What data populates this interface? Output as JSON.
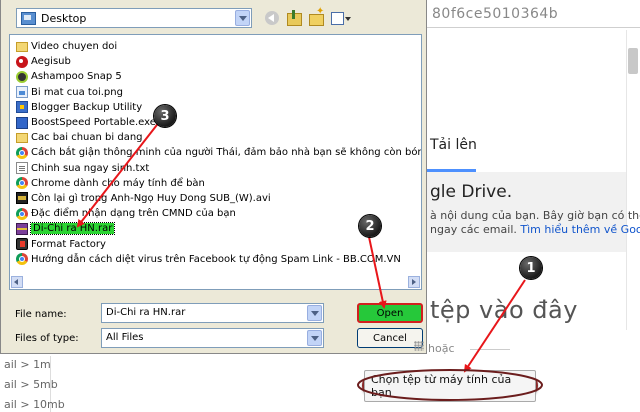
{
  "background": {
    "url_fragment": "80f6ce5010364b",
    "upload_tab": "Tải lên",
    "drive_heading": "gle Drive.",
    "desc_line1": "à nội dung của bạn. Bây giờ bạn có thể",
    "desc_line2_prefix": "ngay các email. ",
    "desc_line2_link": "Tìm hiểu thêm về Goog",
    "drop_text": "tệp vào đây",
    "or_text": "hoặc",
    "left_lines": [
      "ail > 1m",
      "ail > 5mb",
      "ail > 10mb"
    ],
    "choose_button": "Chọn tệp từ máy tính của bạn"
  },
  "dialog": {
    "look_in": "Desktop",
    "items": [
      {
        "name": "Video chuyen doi",
        "icon": "folder-icon"
      },
      {
        "name": "Aegisub",
        "icon": "aegisub-icon"
      },
      {
        "name": "Ashampoo Snap 5",
        "icon": "ashampoo-icon"
      },
      {
        "name": "Bi mat cua toi.png",
        "icon": "png-file-icon"
      },
      {
        "name": "Blogger Backup Utility",
        "icon": "blogger-backup-icon"
      },
      {
        "name": "BoostSpeed Portable.exe",
        "icon": "exe-file-icon"
      },
      {
        "name": "Cac bai chuan bi dang",
        "icon": "folder-icon"
      },
      {
        "name": "Cách bắt giận thông minh của người Thái, đảm bảo nhà bạn sẽ không còn bóng dáng con",
        "icon": "chrome-icon"
      },
      {
        "name": "Chinh sua ngay sinh.txt",
        "icon": "txt-file-icon"
      },
      {
        "name": "Chrome dành cho máy tính để bàn",
        "icon": "chrome-icon"
      },
      {
        "name": "Còn lại gì trong Anh-Ngọ Huy Dong SUB_(W).avi",
        "icon": "avi-file-icon"
      },
      {
        "name": "Đặc điểm nhận dạng trên CMND của bạn",
        "icon": "chrome-icon"
      },
      {
        "name": "Di-Chi ra HN.rar",
        "icon": "rar-file-icon",
        "selected": true
      },
      {
        "name": "Format Factory",
        "icon": "format-factory-icon"
      },
      {
        "name": "Hướng dẫn cách diệt virus trên Facebook tự động Spam Link - BB.COM.VN",
        "icon": "chrome-icon"
      }
    ],
    "file_name_label": "File name:",
    "file_name_value": "Di-Chi ra HN.rar",
    "file_type_label": "Files of type:",
    "file_type_value": "All Files",
    "open_label": "Open",
    "cancel_label": "Cancel"
  },
  "annotations": {
    "step1": "1",
    "step2": "2",
    "step3": "3",
    "arrow_color": "#e8161a",
    "highlight_color": "#2cd433"
  }
}
